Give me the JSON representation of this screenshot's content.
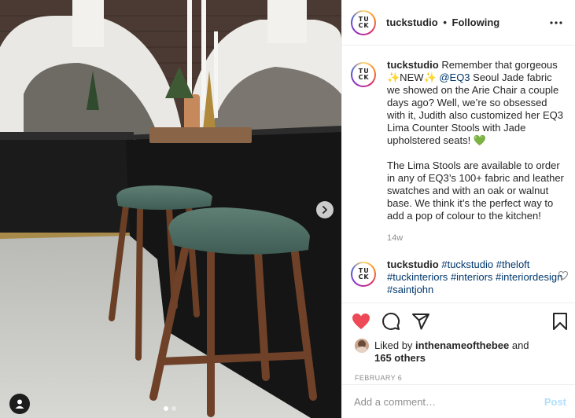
{
  "post": {
    "photo_label": "",
    "author": "tuckstudio",
    "separator": "•",
    "follow_status": "Following",
    "avatar_letters": [
      "T",
      "U",
      "C",
      "K"
    ]
  },
  "caption": {
    "username": "tuckstudio",
    "text_1": " Remember that gorgeous ✨NEW✨ ",
    "mention": "@EQ3",
    "text_2": " Seoul Jade fabric we showed on the Arie Chair a couple days ago? Well, we’re so obsessed with it, Judith also customized her EQ3 Lima Counter Stools with Jade upholstered seats! 💚",
    "paragraph_2": "The Lima Stools are available to order in any of EQ3’s 100+ fabric and leather swatches and with an oak or walnut base. We think it’s the perfect way to add a pop of colour to the kitchen!",
    "time": "14w"
  },
  "comment": {
    "username": "tuckstudio",
    "hashtags": [
      "#tuckstudio",
      "#theloft",
      "#tuckinteriors",
      "#interiors",
      "#interiordesign",
      "#saintjohn"
    ]
  },
  "likes": {
    "prefix": "Liked by ",
    "user": "inthenameofthebee",
    "and": " and",
    "others": "165 others"
  },
  "date": "FEBRUARY 6",
  "add_comment": {
    "placeholder": "Add a comment…",
    "post_label": "Post"
  },
  "carousel": {
    "count": 2,
    "active": 1
  },
  "colors": {
    "link": "#00376b",
    "like": "#ed4956",
    "post_disabled": "#b2dffc",
    "muted": "#8e8e8e"
  },
  "icons": [
    "more-icon",
    "heart-filled-icon",
    "comment-icon",
    "share-icon",
    "bookmark-icon",
    "heart-outline-icon",
    "chevron-right-icon",
    "user-tag-icon"
  ]
}
